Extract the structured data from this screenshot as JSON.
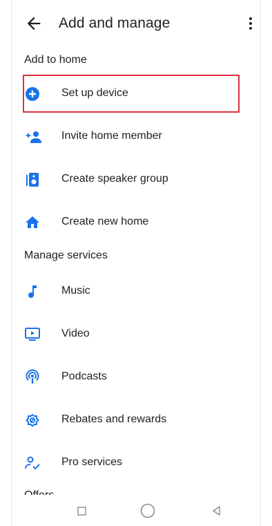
{
  "header": {
    "title": "Add and manage"
  },
  "sections": {
    "add_to_home": "Add to home",
    "manage_services": "Manage services",
    "offers": "Offers"
  },
  "add_items": [
    {
      "label": "Set up device",
      "icon": "add-circle-icon"
    },
    {
      "label": "Invite home member",
      "icon": "person-add-icon"
    },
    {
      "label": "Create speaker group",
      "icon": "speaker-icon"
    },
    {
      "label": "Create new home",
      "icon": "home-icon"
    }
  ],
  "service_items": [
    {
      "label": "Music",
      "icon": "music-note-icon"
    },
    {
      "label": "Video",
      "icon": "video-icon"
    },
    {
      "label": "Podcasts",
      "icon": "podcast-icon"
    },
    {
      "label": "Rebates and rewards",
      "icon": "rebate-icon"
    },
    {
      "label": "Pro services",
      "icon": "pro-services-icon"
    }
  ],
  "colors": {
    "accent": "#1a73e8",
    "highlight": "#d9313d"
  }
}
